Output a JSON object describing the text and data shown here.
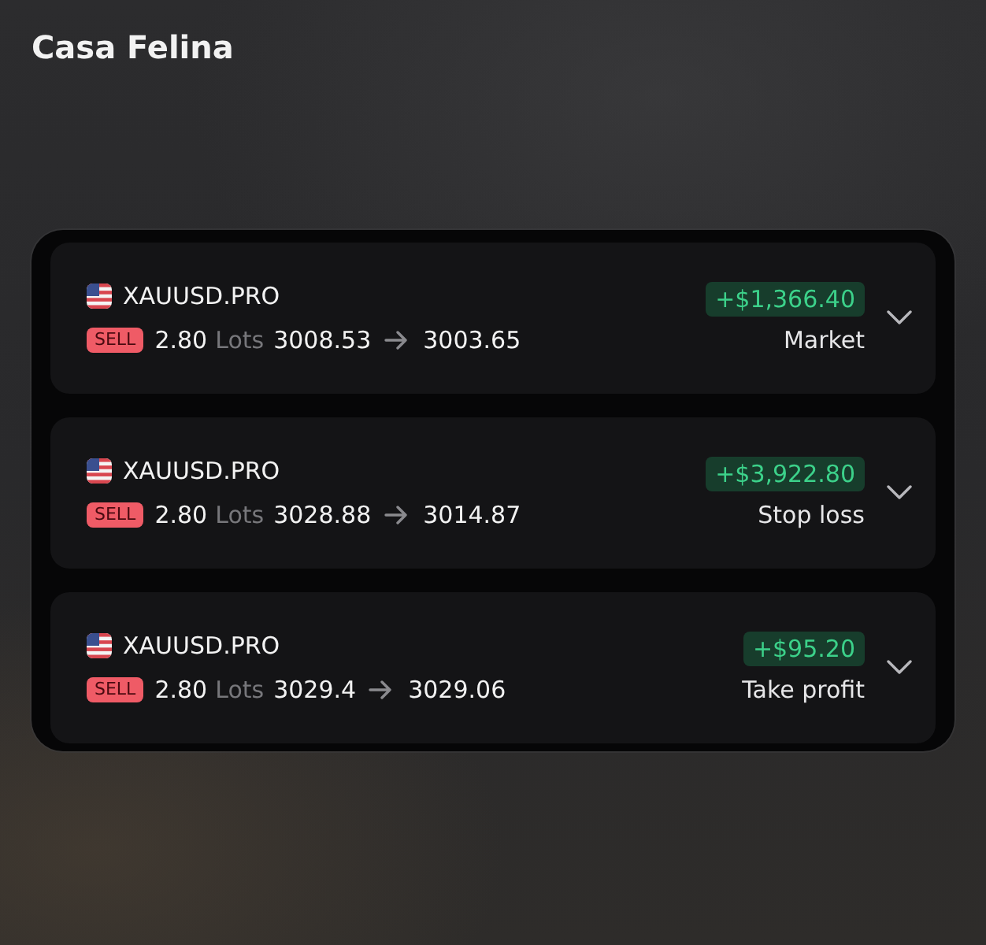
{
  "header": {
    "title": "Casa Felina"
  },
  "positions": [
    {
      "symbol": "XAUUSD.PRO",
      "side": "SELL",
      "volume": "2.80",
      "volume_unit": "Lots",
      "open_price": "3008.53",
      "close_price": "3003.65",
      "profit": "+$1,366.40",
      "close_reason": "Market",
      "expanded": false
    },
    {
      "symbol": "XAUUSD.PRO",
      "side": "SELL",
      "volume": "2.80",
      "volume_unit": "Lots",
      "open_price": "3028.88",
      "close_price": "3014.87",
      "profit": "+$3,922.80",
      "close_reason": "Stop loss",
      "expanded": false
    },
    {
      "symbol": "XAUUSD.PRO",
      "side": "SELL",
      "volume": "2.80",
      "volume_unit": "Lots",
      "open_price": "3029.4",
      "close_price": "3029.06",
      "profit": "+$95.20",
      "close_reason": "Take profit",
      "expanded": false
    }
  ]
}
